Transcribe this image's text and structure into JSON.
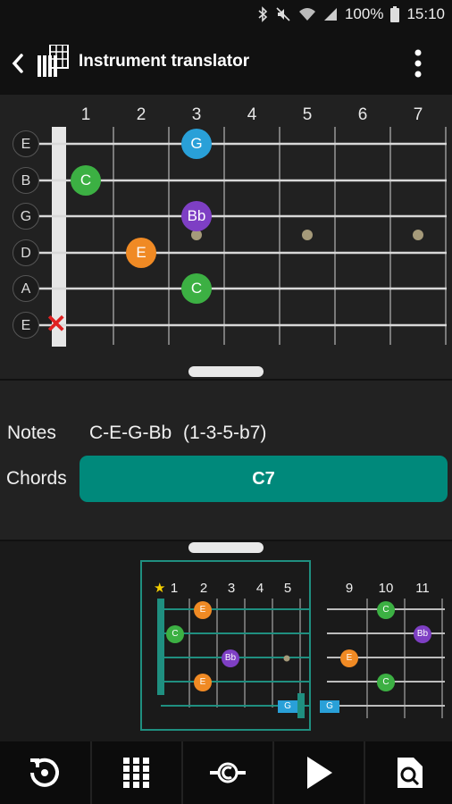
{
  "status": {
    "battery": "100%",
    "time": "15:10"
  },
  "appbar": {
    "title": "Instrument translator"
  },
  "fretboard": {
    "fret_numbers": [
      "1",
      "2",
      "3",
      "4",
      "5",
      "6",
      "7"
    ],
    "string_labels": [
      "E",
      "B",
      "G",
      "D",
      "A",
      "E"
    ],
    "notes": [
      {
        "label": "G",
        "color": "#29a0d8"
      },
      {
        "label": "C",
        "color": "#3cb043"
      },
      {
        "label": "Bb",
        "color": "#7e3fc4"
      },
      {
        "label": "E",
        "color": "#f08a24"
      },
      {
        "label": "C",
        "color": "#3cb043"
      }
    ],
    "muted_marker": "✕"
  },
  "info": {
    "notes_label": "Notes",
    "notes_value": "C-E-G-Bb",
    "intervals": "(1-3-5-b7)",
    "chords_label": "Chords",
    "chord": "C7"
  },
  "lower": {
    "left_numbers": [
      "1",
      "2",
      "3",
      "4",
      "5"
    ],
    "right_numbers": [
      "9",
      "10",
      "11"
    ],
    "star": "★",
    "left_notes": [
      "E",
      "C",
      "Bb",
      "E"
    ],
    "right_notes": [
      "C",
      "Bb",
      "E",
      "C"
    ],
    "g_tags": [
      "G",
      "G"
    ]
  },
  "nav": {
    "icons": [
      "rotate-icon",
      "grid-icon",
      "capo-icon",
      "play-icon",
      "search-doc-icon"
    ]
  },
  "colors": {
    "accent": "#00897b",
    "frame": "#1f8f80"
  }
}
